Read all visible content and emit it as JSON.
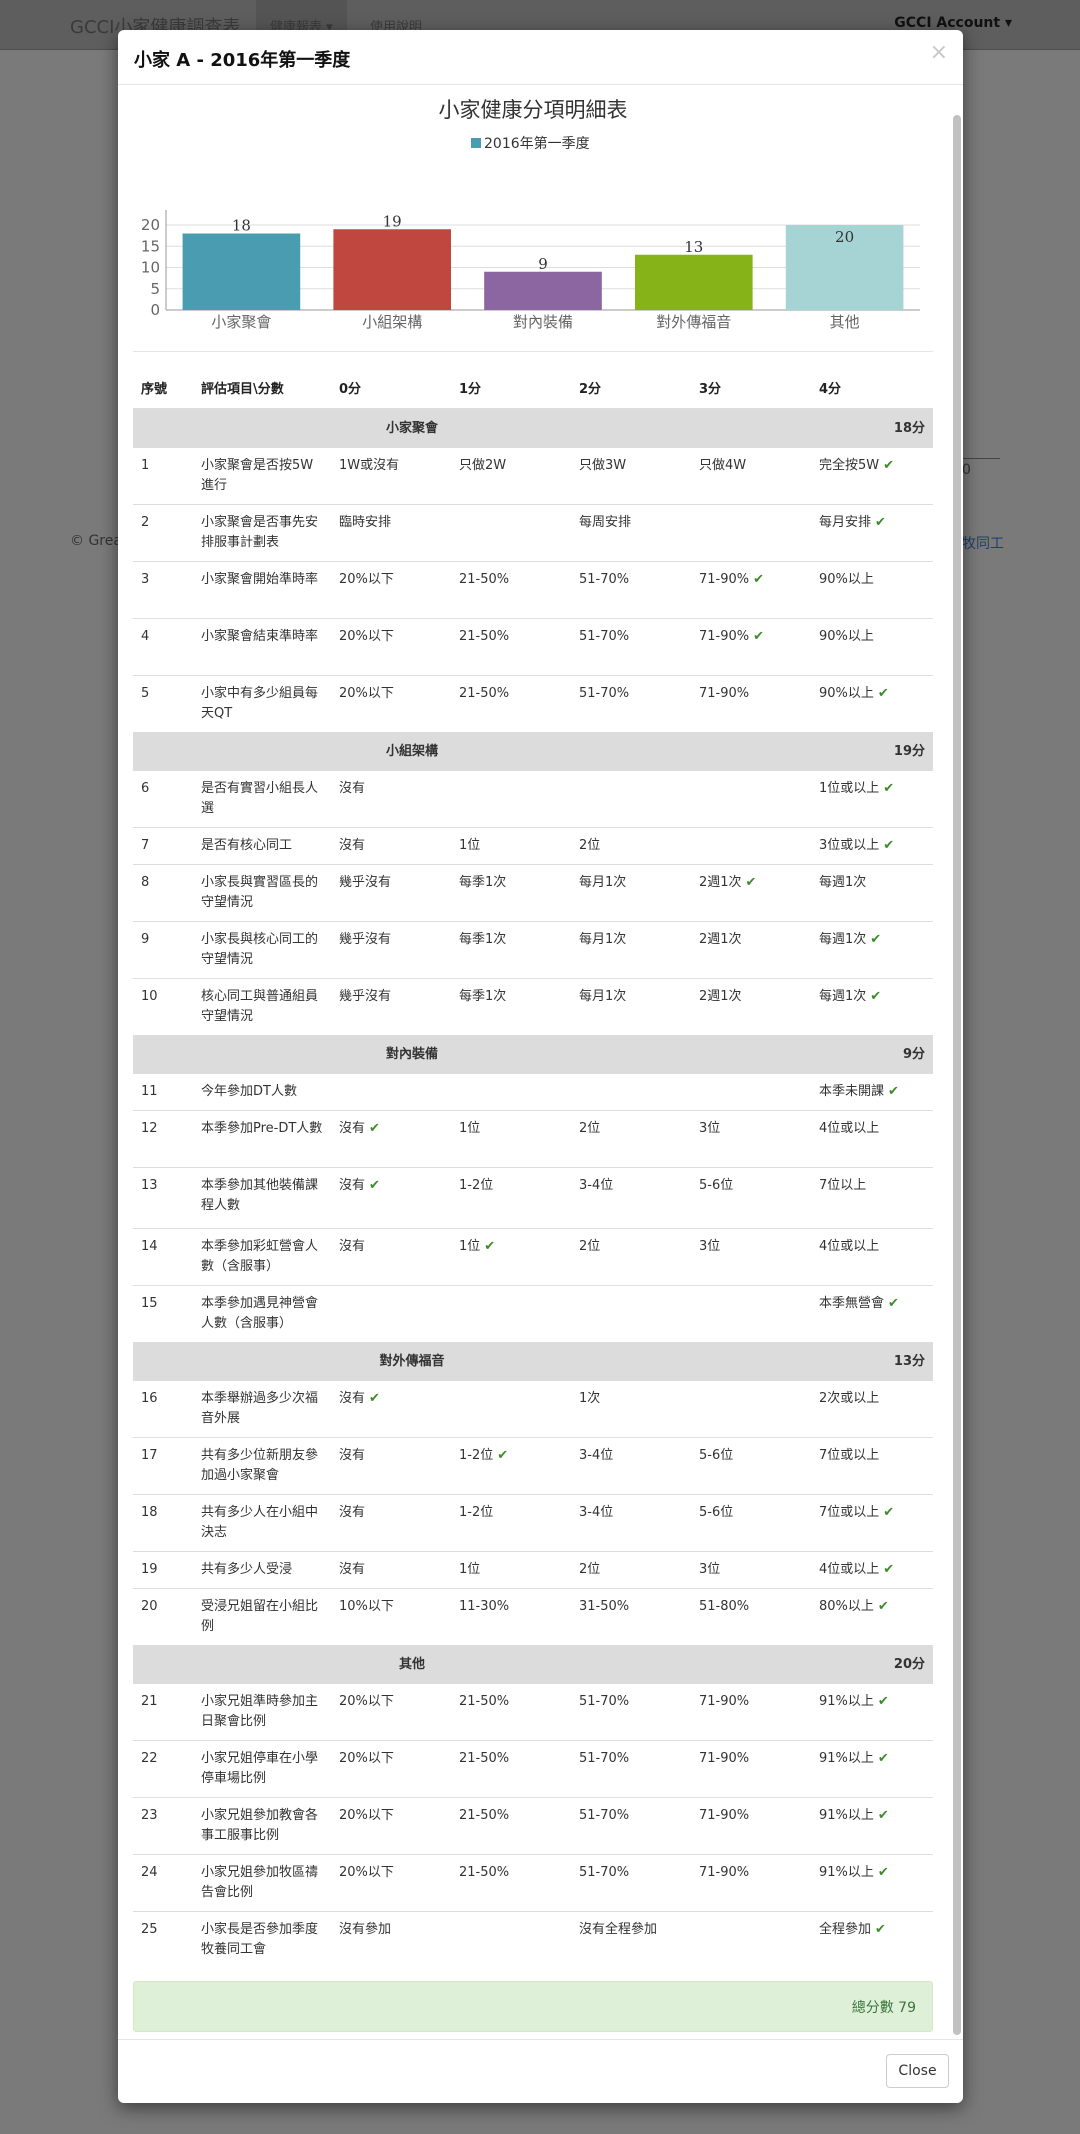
{
  "app": {
    "brand": "GCCI小家健康調查表",
    "nav": [
      "健康報表",
      "使用說明"
    ],
    "account": "GCCI Account",
    "footer_left": "© Great",
    "footer_right": "牧同工",
    "stat": "0"
  },
  "modal": {
    "title": "小家 A - 2016年第一季度",
    "close_label": "Close",
    "total_label": "總分數 79"
  },
  "chart_data": {
    "type": "bar",
    "title": "小家健康分項明細表",
    "categories": [
      "小家聚會",
      "小組架構",
      "對內裝備",
      "對外傳福音",
      "其他"
    ],
    "series": [
      {
        "name": "2016年第一季度",
        "values": [
          18,
          19,
          9,
          13,
          20
        ]
      }
    ],
    "ylim": [
      0,
      20
    ],
    "yticks": [
      0,
      5,
      10,
      15,
      20
    ],
    "colors": [
      "#4a9db1",
      "#c0473f",
      "#8b66a0",
      "#86b418",
      "#a6d3d3"
    ],
    "legend_color": "#4a9db1",
    "grid": true,
    "legend": "top-center"
  },
  "table": {
    "headers": [
      "序號",
      "評估項目\\分數",
      "0分",
      "1分",
      "2分",
      "3分",
      "4分"
    ],
    "sections": [
      {
        "name": "小家聚會",
        "score": "18分",
        "rows": [
          {
            "no": "1",
            "item": "小家聚會是否按5W進行",
            "c": [
              "1W或沒有",
              "只做2W",
              "只做3W",
              "只做4W",
              "完全按5W"
            ],
            "chk": 4
          },
          {
            "no": "2",
            "item": "小家聚會是否事先安排服事計劃表",
            "c": [
              "臨時安排",
              "",
              "每周安排",
              "",
              "每月安排"
            ],
            "chk": 4
          },
          {
            "no": "3",
            "item": "小家聚會開始準時率",
            "c": [
              "20%以下",
              "21-50%",
              "51-70%",
              "71-90%",
              "90%以上"
            ],
            "chk": 3
          },
          {
            "no": "4",
            "item": "小家聚會結束準時率",
            "c": [
              "20%以下",
              "21-50%",
              "51-70%",
              "71-90%",
              "90%以上"
            ],
            "chk": 3
          },
          {
            "no": "5",
            "item": "小家中有多少組員每天QT",
            "c": [
              "20%以下",
              "21-50%",
              "51-70%",
              "71-90%",
              "90%以上"
            ],
            "chk": 4
          }
        ]
      },
      {
        "name": "小組架構",
        "score": "19分",
        "rows": [
          {
            "no": "6",
            "item": "是否有實習小組長人選",
            "c": [
              "沒有",
              "",
              "",
              "",
              "1位或以上"
            ],
            "chk": 4
          },
          {
            "no": "7",
            "item": "是否有核心同工",
            "c": [
              "沒有",
              "1位",
              "2位",
              "",
              "3位或以上"
            ],
            "chk": 4,
            "h": 1
          },
          {
            "no": "8",
            "item": "小家長與實習區長的守望情況",
            "c": [
              "幾乎沒有",
              "每季1次",
              "每月1次",
              "2週1次",
              "每週1次"
            ],
            "chk": 3
          },
          {
            "no": "9",
            "item": "小家長與核心同工的守望情況",
            "c": [
              "幾乎沒有",
              "每季1次",
              "每月1次",
              "2週1次",
              "每週1次"
            ],
            "chk": 4
          },
          {
            "no": "10",
            "item": "核心同工與普通組員守望情況",
            "c": [
              "幾乎沒有",
              "每季1次",
              "每月1次",
              "2週1次",
              "每週1次"
            ],
            "chk": 4
          }
        ]
      },
      {
        "name": "對內裝備",
        "score": "9分",
        "rows": [
          {
            "no": "11",
            "item": "今年參加DT人數",
            "c": [
              "",
              "",
              "",
              "",
              "本季未開課"
            ],
            "chk": 4,
            "h": 1
          },
          {
            "no": "12",
            "item": "本季參加Pre-DT人數",
            "c": [
              "沒有",
              "1位",
              "2位",
              "3位",
              "4位或以上"
            ],
            "chk": 0
          },
          {
            "no": "13",
            "item": "本季參加其他裝備課程人數",
            "c": [
              "沒有",
              "1-2位",
              "3-4位",
              "5-6位",
              "7位以上"
            ],
            "chk": 0,
            "h": 3
          },
          {
            "no": "14",
            "item": "本季參加彩虹營會人數（含服事）",
            "c": [
              "沒有",
              "1位",
              "2位",
              "3位",
              "4位或以上"
            ],
            "chk": 1
          },
          {
            "no": "15",
            "item": "本季參加遇見神營會人數（含服事）",
            "c": [
              "",
              "",
              "",
              "",
              "本季無營會"
            ],
            "chk": 4
          }
        ]
      },
      {
        "name": "對外傳福音",
        "score": "13分",
        "rows": [
          {
            "no": "16",
            "item": "本季舉辦過多少次福音外展",
            "c": [
              "沒有",
              "",
              "1次",
              "",
              "2次或以上"
            ],
            "chk": 0
          },
          {
            "no": "17",
            "item": "共有多少位新朋友參加過小家聚會",
            "c": [
              "沒有",
              "1-2位",
              "3-4位",
              "5-6位",
              "7位或以上"
            ],
            "chk": 1
          },
          {
            "no": "18",
            "item": "共有多少人在小組中決志",
            "c": [
              "沒有",
              "1-2位",
              "3-4位",
              "5-6位",
              "7位或以上"
            ],
            "chk": 4
          },
          {
            "no": "19",
            "item": "共有多少人受浸",
            "c": [
              "沒有",
              "1位",
              "2位",
              "3位",
              "4位或以上"
            ],
            "chk": 4,
            "h": 1
          },
          {
            "no": "20",
            "item": "受浸兄姐留在小組比例",
            "c": [
              "10%以下",
              "11-30%",
              "31-50%",
              "51-80%",
              "80%以上"
            ],
            "chk": 4
          }
        ]
      },
      {
        "name": "其他",
        "score": "20分",
        "rows": [
          {
            "no": "21",
            "item": "小家兄姐準時參加主日聚會比例",
            "c": [
              "20%以下",
              "21-50%",
              "51-70%",
              "71-90%",
              "91%以上"
            ],
            "chk": 4
          },
          {
            "no": "22",
            "item": "小家兄姐停車在小學停車場比例",
            "c": [
              "20%以下",
              "21-50%",
              "51-70%",
              "71-90%",
              "91%以上"
            ],
            "chk": 4
          },
          {
            "no": "23",
            "item": "小家兄姐參加教會各事工服事比例",
            "c": [
              "20%以下",
              "21-50%",
              "51-70%",
              "71-90%",
              "91%以上"
            ],
            "chk": 4
          },
          {
            "no": "24",
            "item": "小家兄姐參加牧區禱告會比例",
            "c": [
              "20%以下",
              "21-50%",
              "51-70%",
              "71-90%",
              "91%以上"
            ],
            "chk": 4
          },
          {
            "no": "25",
            "item": "小家長是否參加季度牧養同工會",
            "c": [
              "沒有參加",
              "",
              "沒有全程參加",
              "",
              "全程參加"
            ],
            "chk": 4
          }
        ]
      }
    ]
  }
}
